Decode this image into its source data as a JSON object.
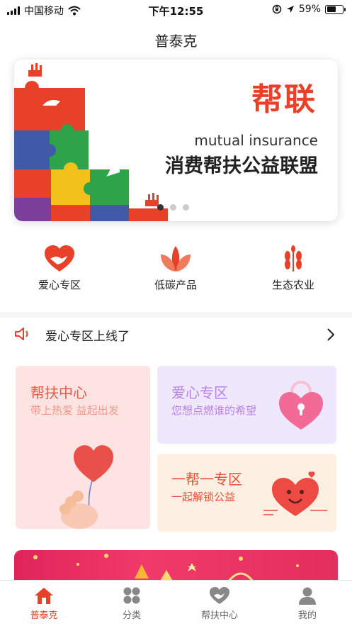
{
  "status_bar": {
    "carrier": "中国移动",
    "time": "下午12:55",
    "battery": "59%",
    "battery_level": 0.59
  },
  "nav": {
    "title": "普泰克"
  },
  "banner": {
    "headline": "帮联",
    "subtitle": "mutual insurance",
    "slogan": "消费帮扶公益联盟",
    "slide_count": 3,
    "active_slide": 1
  },
  "categories": [
    {
      "label": "爱心专区",
      "icon": "heart-hand-icon"
    },
    {
      "label": "低碳产品",
      "icon": "lotus-icon"
    },
    {
      "label": "生态农业",
      "icon": "wheat-icon"
    }
  ],
  "notice": {
    "text": "爱心专区上线了",
    "icon": "speaker-icon"
  },
  "cards": {
    "help_center": {
      "title": "帮扶中心",
      "subtitle": "带上热爱  益起出发"
    },
    "love_zone": {
      "title": "爱心专区",
      "subtitle": "您想点燃谁的希望"
    },
    "one_help_one": {
      "title": "一帮一专区",
      "subtitle": "一起解锁公益"
    }
  },
  "tabs": [
    {
      "label": "普泰克",
      "icon": "home-icon",
      "active": true
    },
    {
      "label": "分类",
      "icon": "grid-icon",
      "active": false
    },
    {
      "label": "帮扶中心",
      "icon": "heart-hand-icon",
      "active": false
    },
    {
      "label": "我的",
      "icon": "user-icon",
      "active": false
    }
  ],
  "colors": {
    "accent": "#e8412a",
    "love_purple": "#b882e6",
    "promo_pink": "#e42f5d"
  }
}
